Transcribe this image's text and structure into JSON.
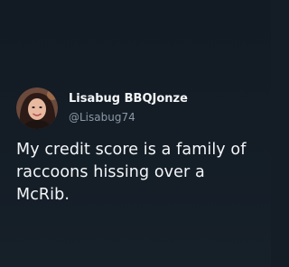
{
  "tweet": {
    "author": {
      "display_name": "Lisabug BBQJonze",
      "handle": "@Lisabug74",
      "avatar_icon": "profile-photo"
    },
    "text": "My credit score is a family of raccoons hissing over a McRib."
  },
  "colors": {
    "background": "#141d26",
    "text_primary": "#f4f6f8",
    "text_secondary": "#8a98a7"
  }
}
